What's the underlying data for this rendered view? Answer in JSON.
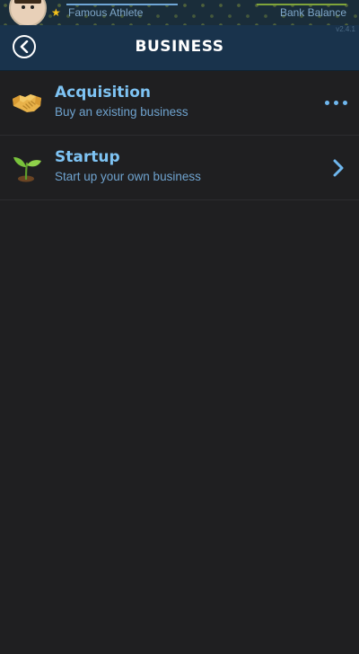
{
  "status_bar": {
    "occupation": "Famous Athlete",
    "balance_label": "Bank Balance",
    "version": "v2.4.1"
  },
  "header": {
    "title": "BUSINESS",
    "back_icon": "chevron-left-circle-icon"
  },
  "items": [
    {
      "title": "Acquisition",
      "subtitle": "Buy an existing business",
      "icon": "handshake-icon",
      "action_icon": "more-dots-icon"
    },
    {
      "title": "Startup",
      "subtitle": "Start up your own business",
      "icon": "sprout-icon",
      "action_icon": "chevron-right-icon"
    }
  ],
  "colors": {
    "background": "#1f1f21",
    "header": "#19334c",
    "accent": "#7ec3f3",
    "subtitle": "#6fa3cf",
    "star": "#f5c21b"
  }
}
